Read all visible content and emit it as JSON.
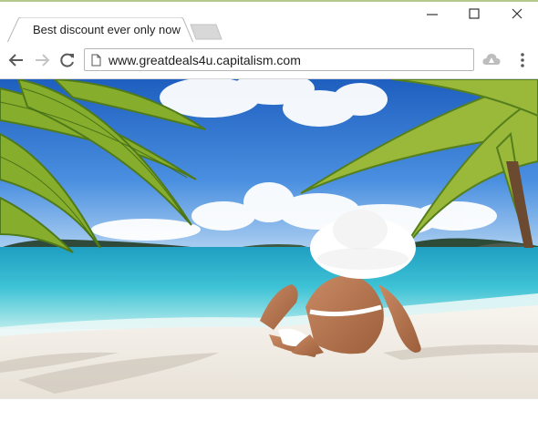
{
  "browser": {
    "tab": {
      "title": "Best discount ever only now"
    },
    "address_bar": {
      "url": "www.greatdeals4u.capitalism.com"
    },
    "icons": {
      "back": "back-arrow-icon",
      "forward": "forward-arrow-icon",
      "reload": "reload-icon",
      "page": "page-icon",
      "extension": "cloud-drive-icon",
      "menu": "menu-dots-icon",
      "minimize": "minimize-icon",
      "maximize": "maximize-icon",
      "close": "close-icon"
    },
    "colors": {
      "accent_line": "#b4c98a",
      "tab_fill": "#ffffff",
      "inactive_tab": "#d8d8d8"
    }
  },
  "page": {
    "image": "beach-vacation-photo",
    "colors": {
      "sky": "#2a6fc9",
      "sea": "#3fc3d6",
      "sand": "#f3efe8",
      "palm": "#7aa22a"
    }
  }
}
